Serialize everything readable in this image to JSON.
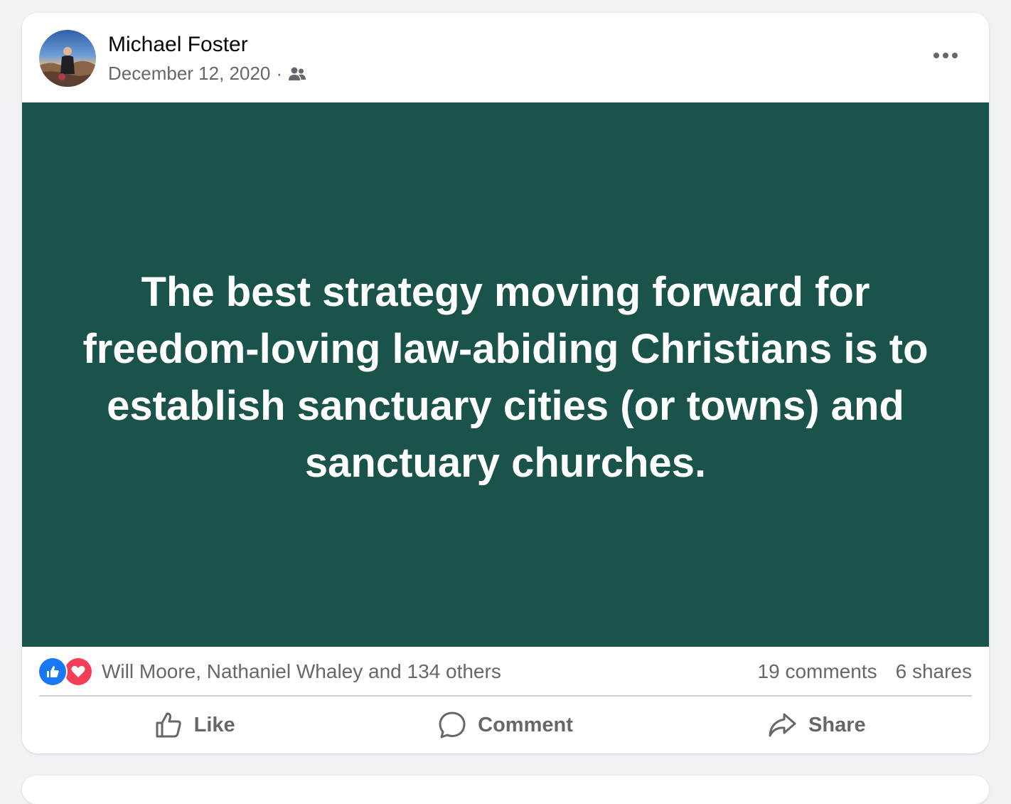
{
  "post": {
    "author": "Michael Foster",
    "date": "December 12, 2020",
    "separator": "·",
    "audience_icon": "friends-icon",
    "more_icon": "more-options-icon",
    "banner": {
      "text": "The best strategy moving forward for freedom-loving law-abiding Christians is to establish sanctuary cities (or towns) and sanctuary churches.",
      "background_color": "#1a534a",
      "text_color": "#ffffff"
    },
    "reactions": {
      "icons": [
        "like-reaction-icon",
        "love-reaction-icon"
      ],
      "summary": "Will Moore, Nathaniel Whaley and 134 others",
      "comments": "19 comments",
      "shares": "6 shares"
    },
    "actions": {
      "like": "Like",
      "comment": "Comment",
      "share": "Share"
    }
  },
  "colors": {
    "page_background": "#f0f2f5",
    "card_background": "#ffffff",
    "secondary_text": "#65676b",
    "primary_text": "#050505",
    "like_blue": "#1877f2",
    "love_red": "#f33e58"
  }
}
